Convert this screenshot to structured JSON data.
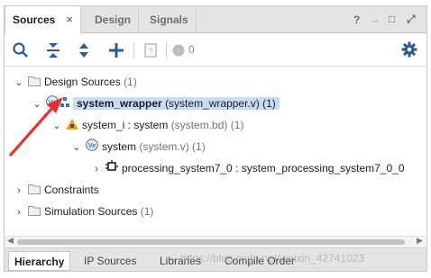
{
  "tabs": [
    {
      "label": "Sources",
      "close": "×"
    },
    {
      "label": "Design"
    },
    {
      "label": "Signals"
    }
  ],
  "window_controls": [
    "?",
    "_",
    "□",
    "⤢"
  ],
  "toolbar": {
    "search": "search-icon",
    "collapse": "collapse-all-icon",
    "expand": "expand-all-icon",
    "add": "add-icon",
    "properties": "properties-icon",
    "count_icon": "status-dot-icon",
    "count": "0",
    "settings": "gear-icon"
  },
  "tree": {
    "design_sources": {
      "label": "Design Sources",
      "count": "(1)"
    },
    "system_wrapper": {
      "name": "system_wrapper",
      "file": "(system_wrapper.v)",
      "count": "(1)"
    },
    "system_i": {
      "name": "system_i : system",
      "file": "(system.bd)",
      "count": "(1)"
    },
    "system": {
      "name": "system",
      "file": "(system.v)",
      "count": "(1)"
    },
    "processing": {
      "label": "processing_system7_0 : system_processing_system7_0_0"
    },
    "constraints": {
      "label": "Constraints"
    },
    "simulation": {
      "label": "Simulation Sources",
      "count": "(1)"
    }
  },
  "bottom_tabs": [
    "Hierarchy",
    "IP Sources",
    "Libraries",
    "Compile Order"
  ],
  "watermark": "https://blog.csdn.net/weixin_42741023",
  "colors": {
    "selection": "#c8dcf8",
    "arrow": "#e8302a",
    "accent": "#3d6fb3"
  }
}
